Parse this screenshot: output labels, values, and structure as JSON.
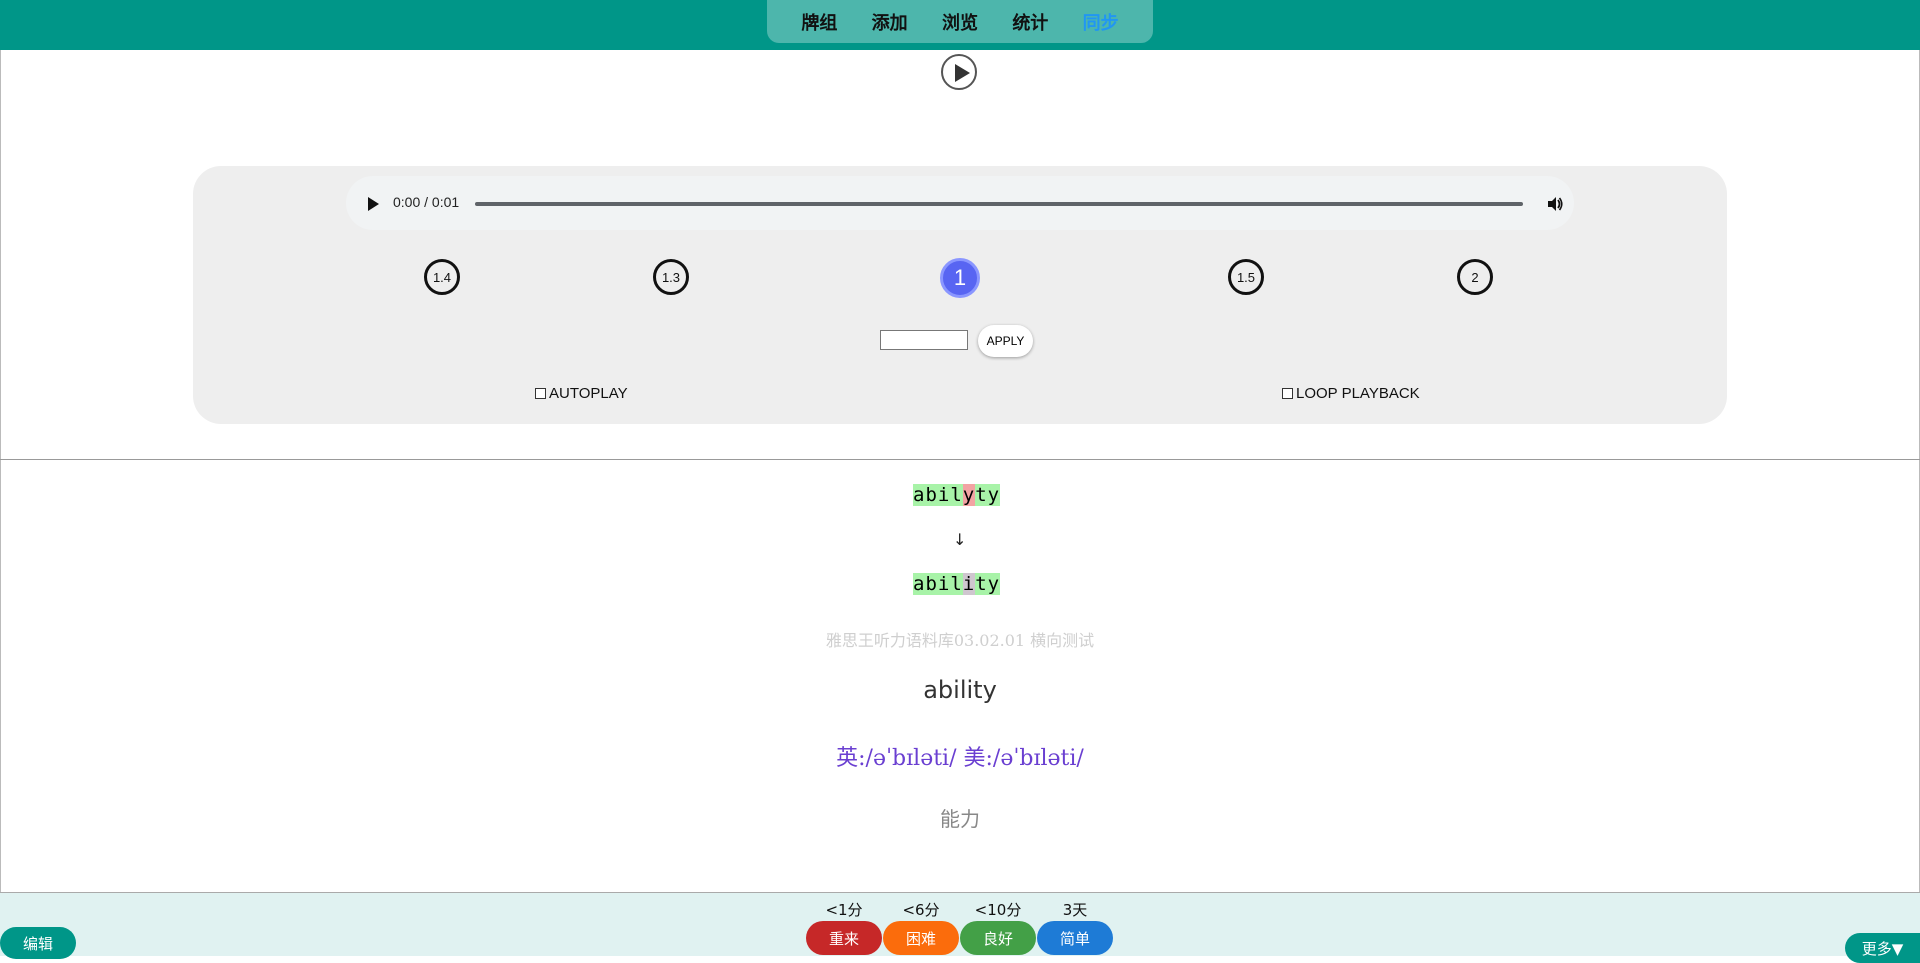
{
  "nav": {
    "tabs": [
      "牌组",
      "添加",
      "浏览",
      "统计",
      "同步"
    ],
    "active_tab": "同步"
  },
  "audio": {
    "time": "0:00 / 0:01"
  },
  "speeds": [
    "1.4",
    "1.3",
    "1",
    "1.5",
    "2"
  ],
  "selected_speed": "1",
  "rate_input": {
    "value": ""
  },
  "apply_label": "APPLY",
  "autoplay_label": "AUTOPLAY",
  "loop_label": "LOOP PLAYBACK",
  "comparison": {
    "typed": "abilyty",
    "arrow": "↓",
    "correct": "ability"
  },
  "card": {
    "deck": "雅思王听力语料库03.02.01 横向测试",
    "word": "ability",
    "phonetic": "英:/əˈbɪləti/  美:/əˈbɪləti/",
    "meaning": "能力"
  },
  "footer": {
    "edit_label": "编辑",
    "more_label": "更多▼",
    "answers": [
      {
        "due": "<1分",
        "label": "重来",
        "color": "#c62828"
      },
      {
        "due": "<6分",
        "label": "困难",
        "color": "#fb6c0c"
      },
      {
        "due": "<10分",
        "label": "良好",
        "color": "#43a047"
      },
      {
        "due": "3天",
        "label": "简单",
        "color": "#1e7bd6"
      }
    ]
  },
  "colors": {
    "header": "#009688",
    "tabs_bg": "#4db6ac",
    "active_tab": "#2196f3",
    "speed_selected": "#5865f2",
    "phonetic": "#6a3fd1"
  }
}
